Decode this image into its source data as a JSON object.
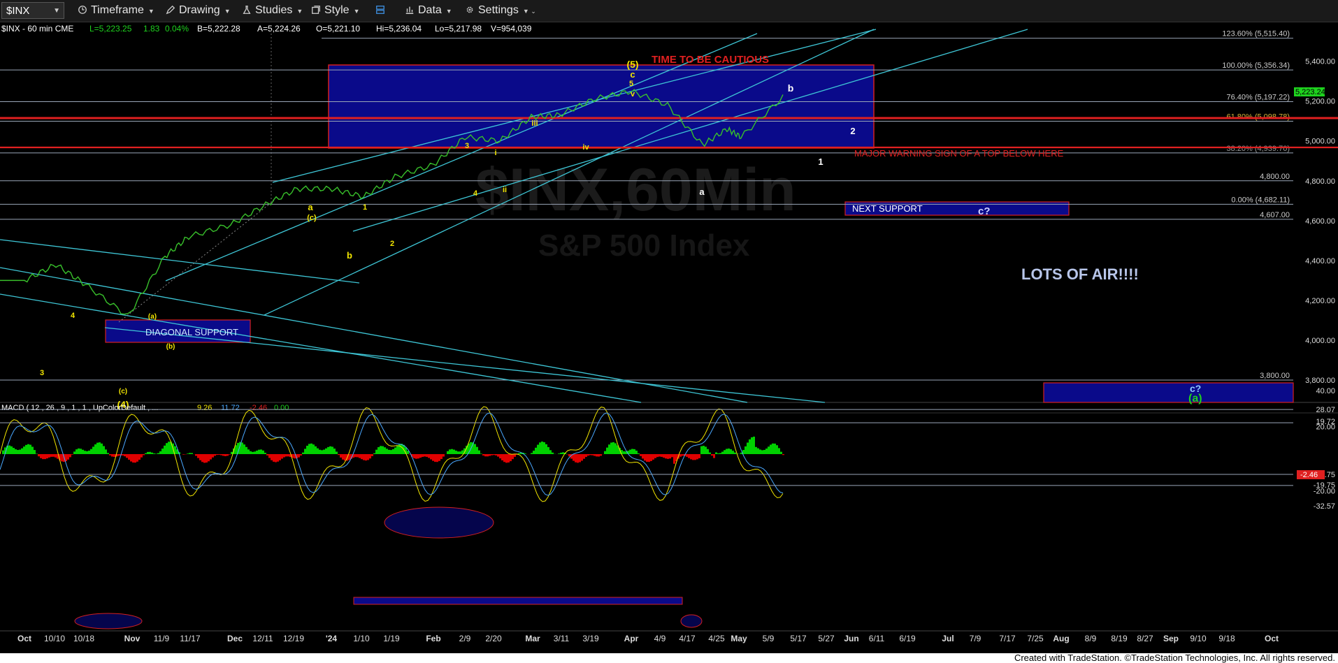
{
  "toolbar": {
    "symbol": "$INX",
    "timeframe": "Timeframe",
    "drawing": "Drawing",
    "studies": "Studies",
    "style": "Style",
    "data": "Data",
    "settings": "Settings"
  },
  "quote": {
    "symbol": "$INX - 60 min  CME",
    "last": "L=5,223.25",
    "change": "1.83",
    "pct": "0.04%",
    "bid": "B=5,222.28",
    "ask": "A=5,224.26",
    "open": "O=5,221.10",
    "high": "Hi=5,236.04",
    "low": "Lo=5,217.98",
    "volume": "V=954,039"
  },
  "price_axis_labels": [
    "5,400.00",
    "5,200.00",
    "5,000.00",
    "4,800.00",
    "4,600.00",
    "4,400.00",
    "4,200.00",
    "4,000.00",
    "3,800.00"
  ],
  "last_price_tag": "5,223.24",
  "level_labels": [
    {
      "text": "123.60% (5,515.40)",
      "price": 5515.4,
      "color": "#cccccc"
    },
    {
      "text": "100.00% (5,356.34)",
      "price": 5356.34,
      "color": "#cccccc"
    },
    {
      "text": "76.40% (5,197.22)",
      "price": 5197.22,
      "color": "#cccccc"
    },
    {
      "text": "61.80% (5,098.78)",
      "price": 5098.78,
      "color": "#d4b23a"
    },
    {
      "text": "38.20% (4,939.70)",
      "price": 4939.7,
      "color": "#999999"
    },
    {
      "text": "4,800.00",
      "price": 4800,
      "color": "#cccccc"
    },
    {
      "text": "0.00% (4,682.11)",
      "price": 4682.11,
      "color": "#cccccc"
    },
    {
      "text": "4,607.00",
      "price": 4607,
      "color": "#cccccc"
    },
    {
      "text": "3,800.00",
      "price": 3800,
      "color": "#cccccc"
    }
  ],
  "annotations": {
    "time_to_be_cautious": "TIME TO BE CAUTIOUS",
    "major_warning": "MAJOR WARNING SIGN OF A TOP BELOW HERE",
    "next_support": "NEXT SUPPORT",
    "c_question": "c?",
    "lots_of_air": "LOTS OF AIR!!!!",
    "diagonal_support": "DIAGONAL SUPPORT",
    "bottom_c": "c?",
    "bottom_a": "(a)",
    "watermark": "$INX,60Min",
    "watermark_sub": "S&P 500 Index"
  },
  "wave_labels": [
    "(5)",
    "c",
    "5",
    "v",
    "b",
    "2",
    "1",
    "a",
    "iii",
    "iv",
    "3",
    "i",
    "ii",
    "4",
    "a",
    "(c)",
    "1",
    "2",
    "b",
    "3",
    "4",
    "(a)",
    "(b)",
    "(c)",
    "(4)"
  ],
  "macd": {
    "title": "MACD ( 12 , 26 , 9 , 1 , 1 , UpColorDefault , ...",
    "v1": "9.26",
    "v2": "11.72",
    "v3": "-2.46",
    "v4": "0.00",
    "axis_labels": [
      "40.00",
      "28.07",
      "19.72",
      "20.00",
      "-12.75",
      "-19.75",
      "-20.00",
      "-32.57"
    ],
    "last_tag": "-2.46"
  },
  "time_axis": [
    "Oct",
    "10/10",
    "10/18",
    "Nov",
    "11/9",
    "11/17",
    "Dec",
    "12/11",
    "12/19",
    "'24",
    "1/10",
    "1/19",
    "Feb",
    "2/9",
    "2/20",
    "Mar",
    "3/11",
    "3/19",
    "Apr",
    "4/9",
    "4/17",
    "4/25",
    "May",
    "5/9",
    "5/17",
    "5/27",
    "Jun",
    "6/11",
    "6/19",
    "Jul",
    "7/9",
    "7/17",
    "7/25",
    "Aug",
    "8/9",
    "8/19",
    "8/27",
    "Sep",
    "9/10",
    "9/18",
    "Oct"
  ],
  "footer": "Created with TradeStation. ©TradeStation Technologies, Inc. All rights reserved.",
  "colors": {
    "price_line": "#38c02b",
    "channel": "#3ec6d6",
    "blue_box": "#0a0a8a",
    "red_line": "#e02020",
    "wave_yellow": "#f2e600",
    "wave_white": "#ffffff",
    "macd_up": "#00d000",
    "macd_down": "#e00000"
  },
  "chart_data": {
    "type": "line",
    "title": "$INX - 60 min",
    "y_range": [
      3700,
      5560
    ],
    "series": [
      {
        "x": [
          "Oct",
          "10/10",
          "10/18",
          "Nov",
          "11/9",
          "11/17",
          "Dec",
          "12/11",
          "12/19",
          "'24",
          "1/10",
          "1/19",
          "Feb",
          "2/9",
          "2/20",
          "Mar",
          "3/11",
          "3/19",
          "Apr",
          "4/9",
          "4/17",
          "4/25",
          "May",
          "5/9"
        ],
        "values": [
          4300,
          4380,
          4280,
          4120,
          4420,
          4520,
          4580,
          4680,
          4760,
          4760,
          4720,
          4820,
          4880,
          5020,
          5000,
          5120,
          5130,
          5210,
          5250,
          5180,
          4980,
          5060,
          5020,
          5220
        ]
      }
    ],
    "macd_range": [
      -40,
      45
    ]
  }
}
